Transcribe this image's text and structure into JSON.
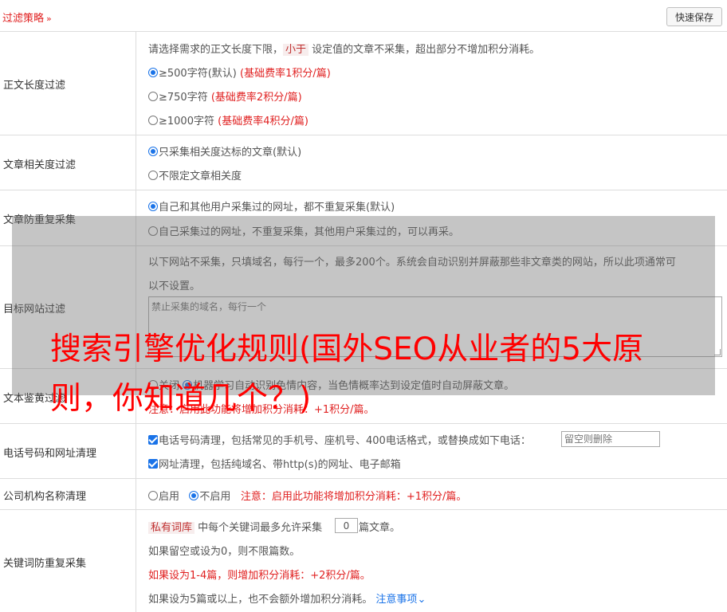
{
  "header": {
    "title": "过滤策略",
    "chevron_icon": "double-chevron-down-icon",
    "save_button": "快速保存"
  },
  "rows": {
    "length_filter": {
      "label": "正文长度过滤",
      "desc_pre": "请选择需求的正文长度下限，",
      "desc_highlight": "小于",
      "desc_post": "设定值的文章不采集，超出部分不增加积分消耗。",
      "options": [
        {
          "text": "≥500字符(默认)",
          "note": "(基础费率1积分/篇)",
          "checked": true
        },
        {
          "text": "≥750字符",
          "note": "(基础费率2积分/篇)",
          "checked": false
        },
        {
          "text": "≥1000字符",
          "note": "(基础费率4积分/篇)",
          "checked": false
        }
      ]
    },
    "relevance_filter": {
      "label": "文章相关度过滤",
      "options": [
        {
          "text": "只采集相关度达标的文章(默认)",
          "checked": true
        },
        {
          "text": "不限定文章相关度",
          "checked": false
        }
      ]
    },
    "dedupe": {
      "label": "文章防重复采集",
      "options": [
        {
          "text": "自己和其他用户采集过的网址，都不重复采集(默认)",
          "checked": true
        },
        {
          "text": "自己采集过的网址，不重复采集，其他用户采集过的，可以再采。",
          "checked": false
        }
      ]
    },
    "site_filter": {
      "label": "目标网站过滤",
      "desc_line1": "以下网站不采集，只填域名，每行一个，最多200个。系统会自动识别并屏蔽那些非文章类的网站，所以此项通常可",
      "desc_line2": "以不设置。",
      "placeholder": "禁止采集的域名，每行一个"
    },
    "porn_filter": {
      "label": "文本鉴黄过滤",
      "option_off": "关闭",
      "option_on_text": "机器学习自动识别色情内容，当色情概率达到设定值时自动屏蔽文章。",
      "note": "注意：启用此功能将增加积分消耗：+1积分/篇。"
    },
    "phone_url": {
      "label": "电话号码和网址清理",
      "phone_text": "电话号码清理，包括常见的手机号、座机号、400电话格式，或替换成如下电话：",
      "phone_placeholder": "留空则删除",
      "url_text": "网址清理，包括纯域名、带http(s)的网址、电子邮箱"
    },
    "company": {
      "label": "公司机构名称清理",
      "enable": "启用",
      "disable": "不启用",
      "note": "注意：启用此功能将增加积分消耗：+1积分/篇。"
    },
    "keyword_dedupe": {
      "label": "关键词防重复采集",
      "tag": "私有词库",
      "desc_pre": "中每个关键词最多允许采集",
      "count": "0",
      "desc_post": "篇文章。",
      "line2": "如果留空或设为0，则不限篇数。",
      "line3": "如果设为1-4篇，则增加积分消耗：+2积分/篇。",
      "line4": "如果设为5篇或以上，也不会额外增加积分消耗。",
      "notice_link": "注意事项",
      "notice_icon": "chevron-down-icon"
    }
  },
  "overlay": {
    "title": "搜索引擎优化规则(国外SEO从业者的5大原则，你知道几个？)"
  },
  "colors": {
    "accent_red": "#e02020",
    "link_blue": "#1a73e8",
    "border": "#dddddd"
  }
}
